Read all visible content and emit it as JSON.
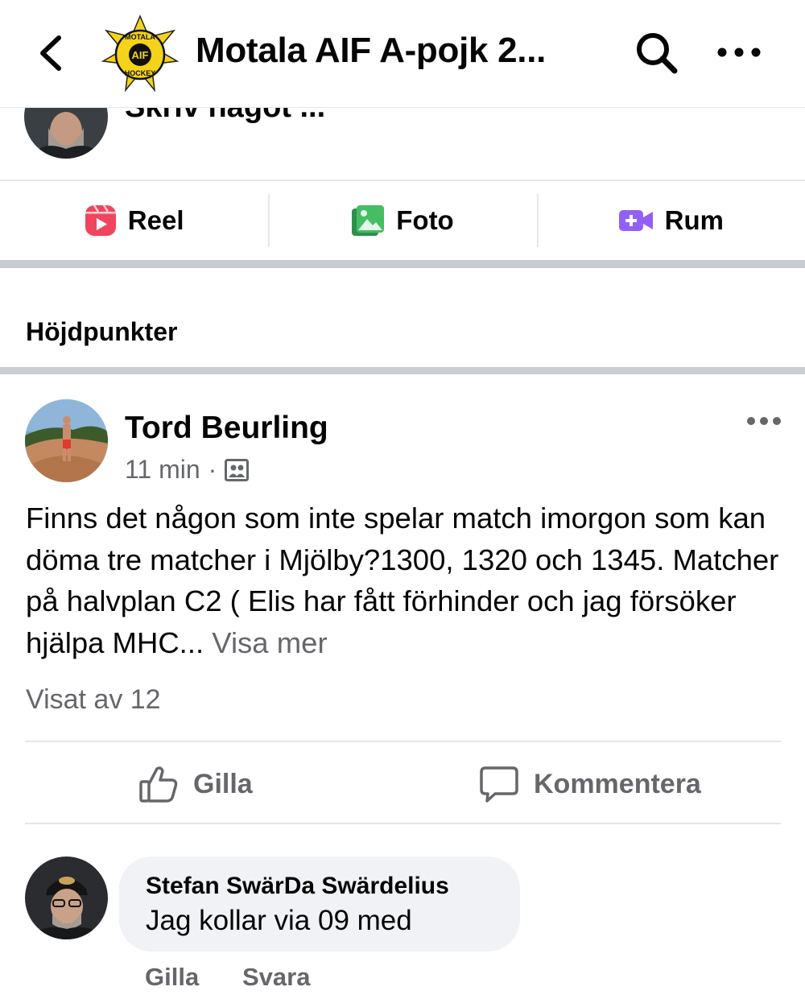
{
  "header": {
    "title": "Motala AIF A-pojk 2...",
    "logo_text_top": "MOTALA",
    "logo_text_center": "AIF",
    "logo_text_bottom": "HOCKEY"
  },
  "composer": {
    "placeholder": "Skriv något ..."
  },
  "actions": {
    "reel": "Reel",
    "photo": "Foto",
    "room": "Rum"
  },
  "section": {
    "title": "Höjdpunkter"
  },
  "post": {
    "author": "Tord Beurling",
    "time": "11 min",
    "separator": "·",
    "body": "Finns det någon som inte spelar match imorgon som kan döma tre matcher i Mjölby?1300,  1320 och 1345. Matcher på halvplan C2 ( Elis har fått förhinder och jag försöker hjälpa MHC...",
    "see_more": "Visa mer",
    "views": "Visat av 12",
    "like_label": "Gilla",
    "comment_label": "Kommentera"
  },
  "comment": {
    "author": "Stefan SwärDa Swärdelius",
    "text": "Jag kollar via 09 med",
    "like_label": "Gilla",
    "reply_label": "Svara"
  },
  "colors": {
    "reel_accent": "#f0455e",
    "photo_accent": "#45bd62",
    "room_accent": "#9360f7",
    "logo_yellow": "#f5d31a",
    "secondary_text": "#65676b"
  },
  "icons": {
    "back": "chevron-left-icon",
    "search": "search-icon",
    "more": "more-horizontal-icon",
    "reel": "reel-icon",
    "photo": "photo-icon",
    "room": "video-room-icon",
    "audience": "group-audience-icon",
    "like": "thumbs-up-icon",
    "comment": "comment-bubble-icon"
  }
}
